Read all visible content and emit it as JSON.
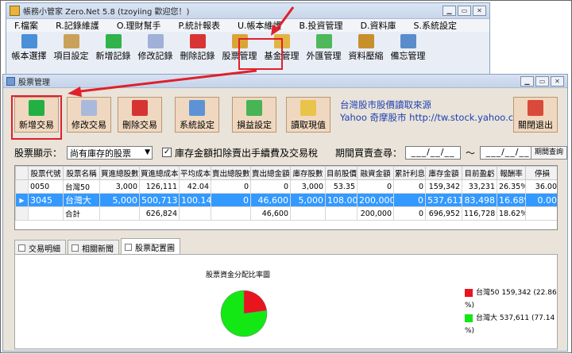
{
  "app_window": {
    "title": "帳務小管家 Zero.Net 5.8 (tzoyiing 歡迎您！)",
    "menu": [
      "F.檔案",
      "R.記錄維護",
      "O.理財幫手",
      "P.統計報表",
      "U.帳本維護",
      "B.投資管理",
      "D.資料庫",
      "S.系統設定"
    ],
    "toolbar": [
      "帳本選擇",
      "項目設定",
      "新增記錄",
      "修改記錄",
      "刪除記錄",
      "股票管理",
      "基金管理",
      "外匯管理",
      "資料壓縮",
      "備忘管理"
    ]
  },
  "stock_window": {
    "title": "股票管理",
    "buttons": [
      "新增交易",
      "修改交易",
      "刪除交易",
      "系統設定",
      "損益設定",
      "讀取現值",
      "關閉退出"
    ],
    "info_line1": "台灣股市股價讀取來源",
    "info_line2": "Yahoo 奇摩股市 http://tw.stock.yahoo.com",
    "filter": {
      "label": "股票顯示：",
      "selected": "尚有庫存的股票",
      "checkbox_label": "庫存金額扣除賣出手續費及交易稅",
      "checkbox_checked": true,
      "period_label": "期間買賣查尋：",
      "date_from": "___/__/__",
      "tilde": "～",
      "date_to": "___/__/__",
      "query_button": "期間查詢"
    },
    "table": {
      "columns": [
        "股票代號",
        "股票名稱",
        "買進總股數",
        "買進總成本",
        "平均成本",
        "賣出總股數",
        "賣出總金額",
        "庫存股數",
        "目前股價",
        "融資金額",
        "累計利息",
        "庫存金額",
        "目前盈虧",
        "報酬率",
        "停損"
      ],
      "rows": [
        [
          "0050",
          "台灣50",
          "3,000",
          "126,111",
          "42.04",
          "0",
          "0",
          "3,000",
          "53.35",
          "0",
          "0",
          "159,342",
          "33,231",
          "26.35%",
          "36.00"
        ],
        [
          "3045",
          "台灣大",
          "5,000",
          "500,713",
          "100.14",
          "0",
          "46,600",
          "5,000",
          "108.00",
          "200,000",
          "0",
          "537,611",
          "83,498",
          "16.68%",
          "0.00"
        ],
        [
          "",
          "合計",
          "",
          "626,824",
          "",
          "",
          "46,600",
          "",
          "",
          "200,000",
          "0",
          "696,952",
          "116,728",
          "18.62%",
          ""
        ]
      ],
      "selected_row_marker": "▶"
    },
    "tabs": [
      "交易明細",
      "相關新聞",
      "股票配置圖"
    ],
    "active_tab": "股票配置圖",
    "chart_data": {
      "type": "pie",
      "title": "股票資金分配比率圖",
      "categories": [
        "台灣50",
        "台灣大"
      ],
      "values": [
        159342,
        537611
      ],
      "legend": [
        "台灣50 159,342 (22.86 %)",
        "台灣大 537,611 (77.14 %)"
      ],
      "colors": [
        "#e8141e",
        "#14e814"
      ],
      "legend_position": "right"
    }
  },
  "colors": {
    "highlight": "#e0202a",
    "selection": "#3399ff",
    "info_text": "#1f3fb3"
  }
}
